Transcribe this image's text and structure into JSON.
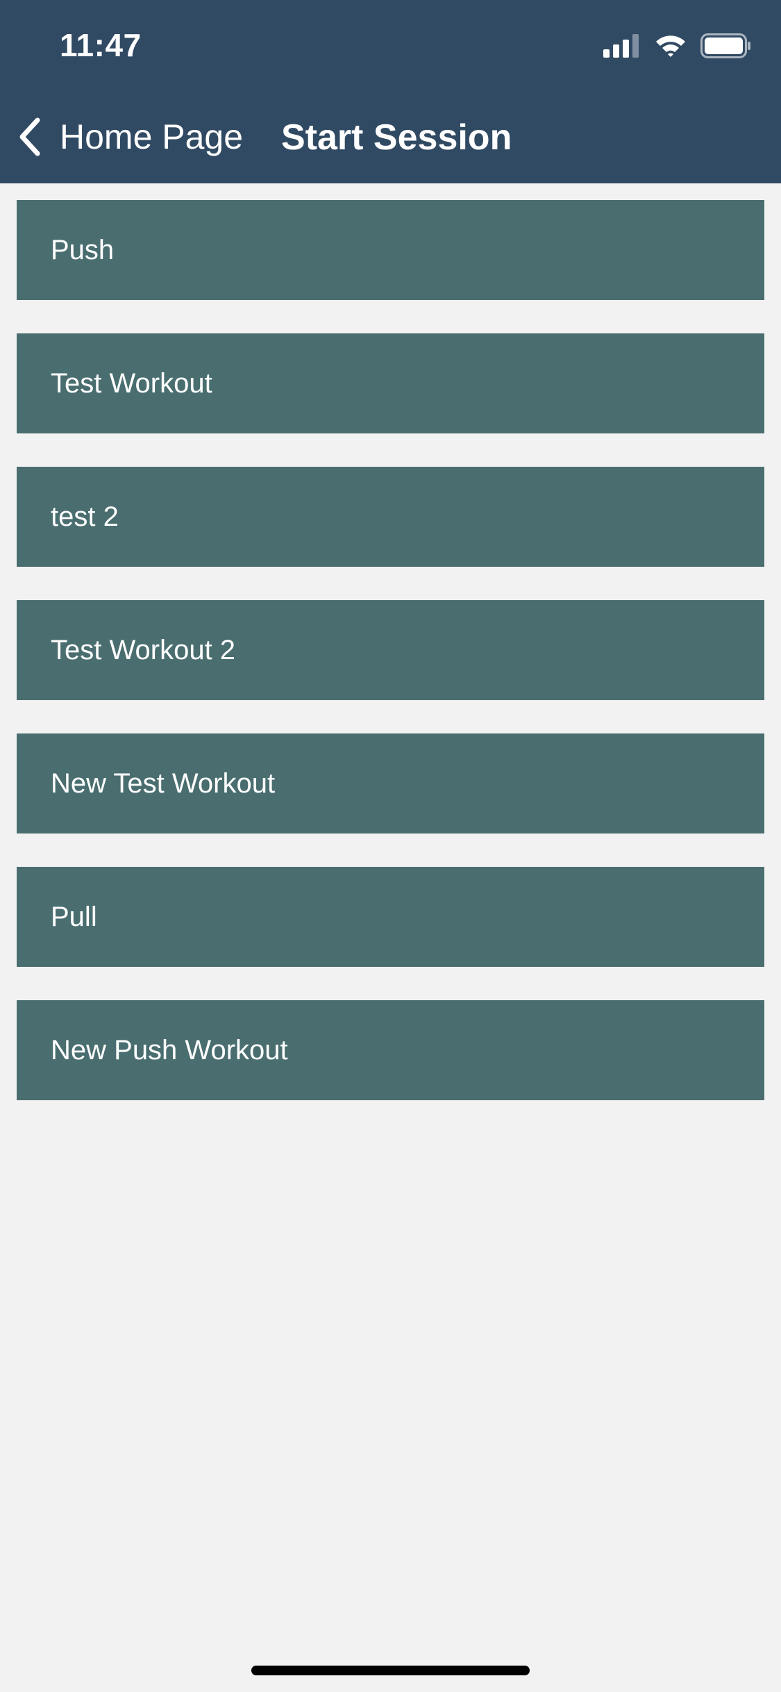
{
  "status_bar": {
    "time": "11:47",
    "icons": [
      "cellular-signal-icon",
      "wifi-icon",
      "battery-icon"
    ]
  },
  "nav": {
    "back_label": "Home Page",
    "back_icon": "chevron-left-icon",
    "title": "Start Session"
  },
  "workouts": [
    {
      "label": "Push"
    },
    {
      "label": "Test Workout"
    },
    {
      "label": "test 2"
    },
    {
      "label": "Test Workout 2"
    },
    {
      "label": "New Test Workout"
    },
    {
      "label": "Pull"
    },
    {
      "label": "New Push Workout"
    }
  ],
  "colors": {
    "header": "#314a63",
    "list_item": "#4a6e70",
    "background": "#f2f2f2",
    "text_light": "#ffffff"
  }
}
